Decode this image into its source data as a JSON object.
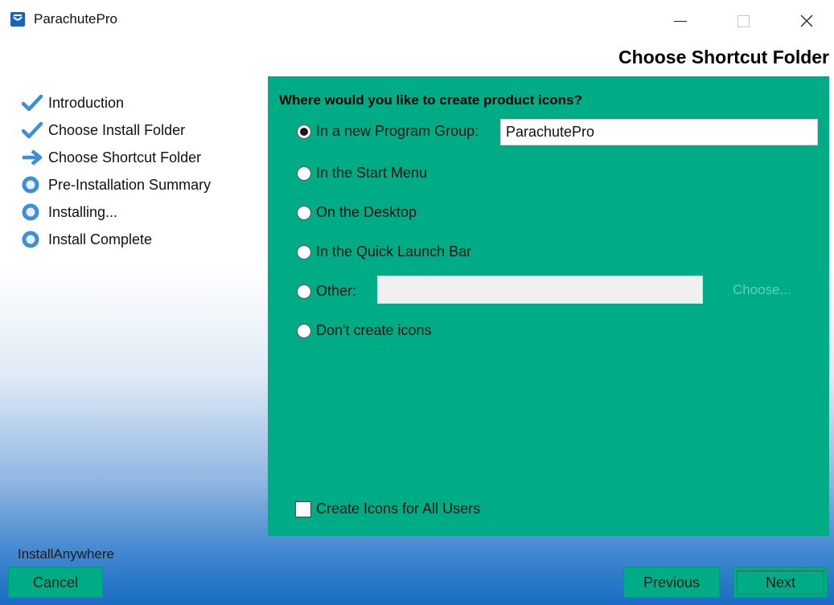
{
  "window": {
    "title": "ParachutePro",
    "icon": "parachutepro-app-icon",
    "controls": [
      "minimize-icon",
      "maximize-icon",
      "close-icon"
    ]
  },
  "heading": "Choose Shortcut Folder",
  "steps": [
    {
      "label": "Introduction",
      "status": "done",
      "icon": "checkmark-icon"
    },
    {
      "label": "Choose Install Folder",
      "status": "done",
      "icon": "checkmark-icon"
    },
    {
      "label": "Choose Shortcut Folder",
      "status": "current",
      "icon": "arrow-right-icon"
    },
    {
      "label": "Pre-Installation Summary",
      "status": "pending",
      "icon": "circle-icon"
    },
    {
      "label": "Installing...",
      "status": "pending",
      "icon": "circle-icon"
    },
    {
      "label": "Install Complete",
      "status": "pending",
      "icon": "circle-icon"
    }
  ],
  "panel": {
    "question": "Where would you like to create product icons?",
    "options": [
      {
        "label": "In a new Program Group:",
        "checked": true
      },
      {
        "label": "In the Start Menu",
        "checked": false
      },
      {
        "label": "On the Desktop",
        "checked": false
      },
      {
        "label": "In the Quick Launch Bar",
        "checked": false
      },
      {
        "label": "Other:",
        "checked": false
      },
      {
        "label": "Don't create icons",
        "checked": false
      }
    ],
    "program_group_value": "ParachutePro",
    "other_value": "",
    "choose_label": "Choose...",
    "all_users_label": "Create Icons for All Users",
    "all_users_checked": false
  },
  "brand": "InstallAnywhere",
  "buttons": {
    "cancel": "Cancel",
    "previous": "Previous",
    "next": "Next"
  },
  "colors": {
    "panel": "#00ac85",
    "check": "#3a8fd6",
    "circle": "#3f8fd6"
  }
}
